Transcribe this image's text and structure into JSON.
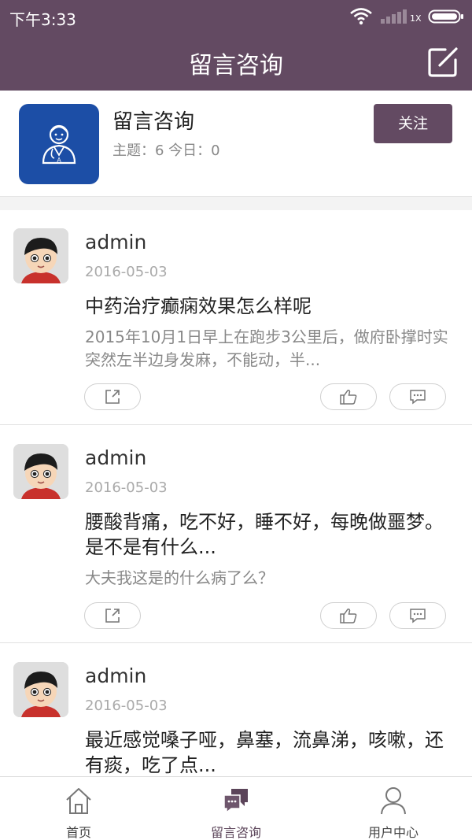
{
  "status_bar": {
    "time": "下午3:33",
    "network": "1X"
  },
  "app_bar": {
    "title": "留言咨询",
    "edit_icon": "compose-icon"
  },
  "board": {
    "name": "留言咨询",
    "stats": "主题：6  今日：0",
    "follow_label": "关注",
    "logo_icon": "doctor-icon",
    "logo_color": "#1c4ea6"
  },
  "colors": {
    "accent": "#634a62",
    "muted_text": "#888888",
    "date_text": "#aaaaaa"
  },
  "posts": [
    {
      "author": "admin",
      "date": "2016-05-03",
      "title": "中药治疗癫痫效果怎么样呢",
      "excerpt": "2015年10月1日早上在跑步3公里后，做府卧撑时实突然左半边身发麻，不能动，半..."
    },
    {
      "author": "admin",
      "date": "2016-05-03",
      "title": "腰酸背痛，吃不好，睡不好，每晚做噩梦。是不是有什么...",
      "excerpt": "大夫我这是的什么病了么？"
    },
    {
      "author": "admin",
      "date": "2016-05-03",
      "title": "最近感觉嗓子哑，鼻塞，流鼻涕，咳嗽，还有痰，吃了点..."
    }
  ],
  "tabs": [
    {
      "label": "首页",
      "icon": "home-icon"
    },
    {
      "label": "留言咨询",
      "icon": "chat-bubbles-icon"
    },
    {
      "label": "用户中心",
      "icon": "user-icon"
    }
  ]
}
